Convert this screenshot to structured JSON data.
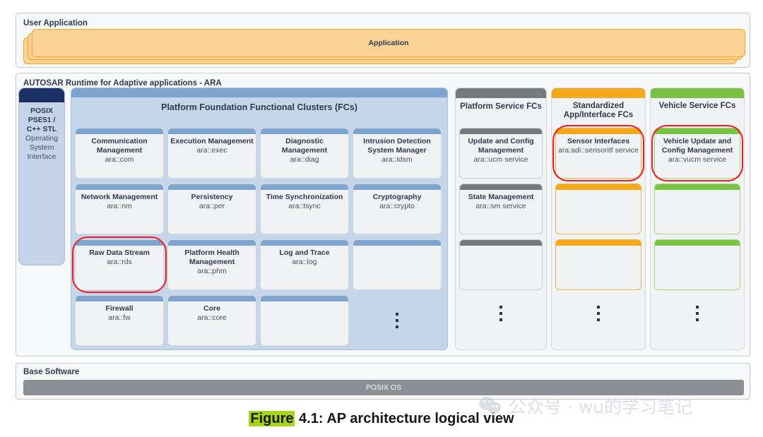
{
  "user_application": {
    "title": "User Application",
    "app_label": "Application"
  },
  "ara": {
    "title": "AUTOSAR Runtime for Adaptive applications - ARA",
    "posix": {
      "line1": "POSIX",
      "line2": "PSE51 /",
      "line3": "C++ STL",
      "line4": "Operating",
      "line5": "System",
      "line6": "Interface"
    },
    "platform_foundation": {
      "title": "Platform Foundation Functional Clusters (FCs)",
      "cells": [
        {
          "name": "Communication Management",
          "api": "ara::com",
          "highlighted": false
        },
        {
          "name": "Execution Management",
          "api": "ara::exec",
          "highlighted": false
        },
        {
          "name": "Diagnostic Management",
          "api": "ara::diag",
          "highlighted": false
        },
        {
          "name": "Intrusion Detection System Manager",
          "api": "ara::idsm",
          "highlighted": false
        },
        {
          "name": "Network Management",
          "api": "ara::nm",
          "highlighted": false
        },
        {
          "name": "Persistency",
          "api": "ara::per",
          "highlighted": false
        },
        {
          "name": "Time Synchronization",
          "api": "ara::tsync",
          "highlighted": false
        },
        {
          "name": "Cryptography",
          "api": "ara::crypto",
          "highlighted": false
        },
        {
          "name": "Raw Data Stream",
          "api": "ara::rds",
          "highlighted": true
        },
        {
          "name": "Platform Health Management",
          "api": "ara::phm",
          "highlighted": false
        },
        {
          "name": "Log and Trace",
          "api": "ara::log",
          "highlighted": false
        },
        {
          "name": "",
          "api": "",
          "highlighted": false
        },
        {
          "name": "Firewall",
          "api": "ara::fw",
          "highlighted": false
        },
        {
          "name": "Core",
          "api": "ara::core",
          "highlighted": false
        },
        {
          "name": "",
          "api": "",
          "highlighted": false
        }
      ],
      "more_indicator": "vertical-ellipsis"
    },
    "platform_service": {
      "title": "Platform Service FCs",
      "cells": [
        {
          "name": "Update and Config Management",
          "api": "ara::ucm service",
          "highlighted": false
        },
        {
          "name": "State Management",
          "api": "ara::sm service",
          "highlighted": false
        },
        {
          "name": "",
          "api": "",
          "highlighted": false
        }
      ],
      "more_indicator": "vertical-ellipsis"
    },
    "standardized_app": {
      "title_line1": "Standardized",
      "title_line2": "App/Interface FCs",
      "cells": [
        {
          "name": "Sensor Interfaces",
          "api": "ara:adi::sensoritf service",
          "highlighted": true
        },
        {
          "name": "",
          "api": "",
          "highlighted": false
        },
        {
          "name": "",
          "api": "",
          "highlighted": false
        }
      ],
      "more_indicator": "vertical-ellipsis"
    },
    "vehicle_service": {
      "title": "Vehicle Service FCs",
      "cells": [
        {
          "name": "Vehicle Update and Config Management",
          "api": "ara::vucm service",
          "highlighted": true
        },
        {
          "name": "",
          "api": "",
          "highlighted": false
        },
        {
          "name": "",
          "api": "",
          "highlighted": false
        }
      ],
      "more_indicator": "vertical-ellipsis"
    }
  },
  "base_software": {
    "title": "Base Software",
    "os_label": "POSIX OS"
  },
  "caption": {
    "figure_word": "Figure",
    "rest": " 4.1: AP architecture logical view",
    "highlight_color": "#a8d318"
  },
  "watermark": {
    "text": "公众号 · wu的学习笔记",
    "icon": "wechat-icon"
  },
  "colors": {
    "application_fill": "#fbd296",
    "application_stroke": "#f5a623",
    "posix_header": "#1c3166",
    "posix_fill": "#c5d4ea",
    "platform_foundation_fill": "#c5d6ea",
    "blue_cap": "#7ea5cf",
    "gray_cap": "#77797c",
    "orange_cap": "#f6a81c",
    "green_cap": "#79c243",
    "annotation_ring": "#ee1c25",
    "posix_os_bar": "#8c8f93"
  }
}
